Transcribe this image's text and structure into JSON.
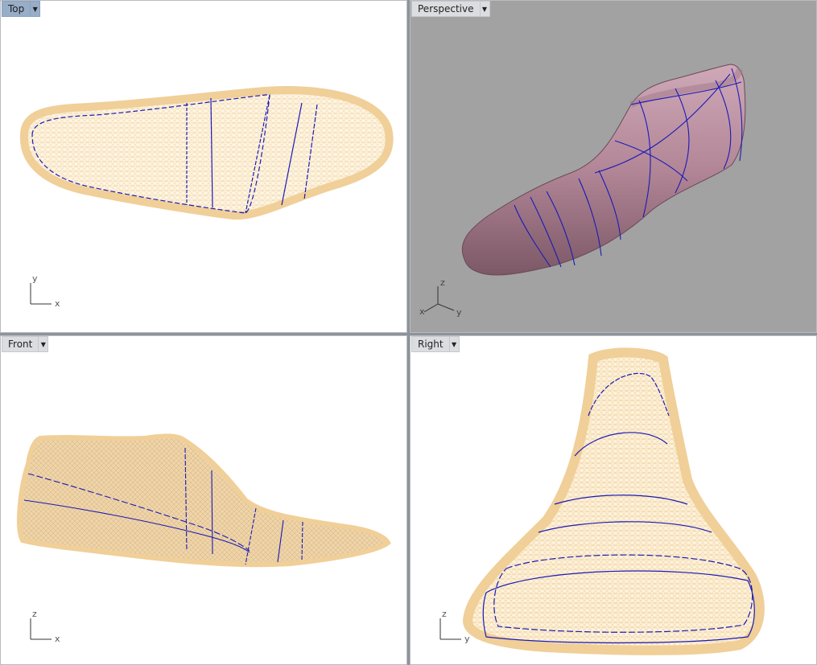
{
  "viewports": {
    "top": {
      "title": "Top",
      "axis": {
        "h": "x",
        "v": "y"
      },
      "active": true
    },
    "perspective": {
      "title": "Perspective",
      "axis": {
        "a": "z",
        "b": "x",
        "c": "y"
      },
      "active": false
    },
    "front": {
      "title": "Front",
      "axis": {
        "h": "x",
        "v": "z"
      },
      "active": false
    },
    "right": {
      "title": "Right",
      "axis": {
        "h": "y",
        "v": "z"
      },
      "active": false
    }
  },
  "colors": {
    "wireframe_fill": "#f2d6a6",
    "wireframe_line": "#e8c58e",
    "curve": "#1a1ab8",
    "shaded_object": "#b58a9a",
    "perspective_background": "#a2a2a2",
    "active_tab": "#98adc8"
  },
  "icons": {
    "viewport_menu": "dropdown-arrow-icon"
  }
}
